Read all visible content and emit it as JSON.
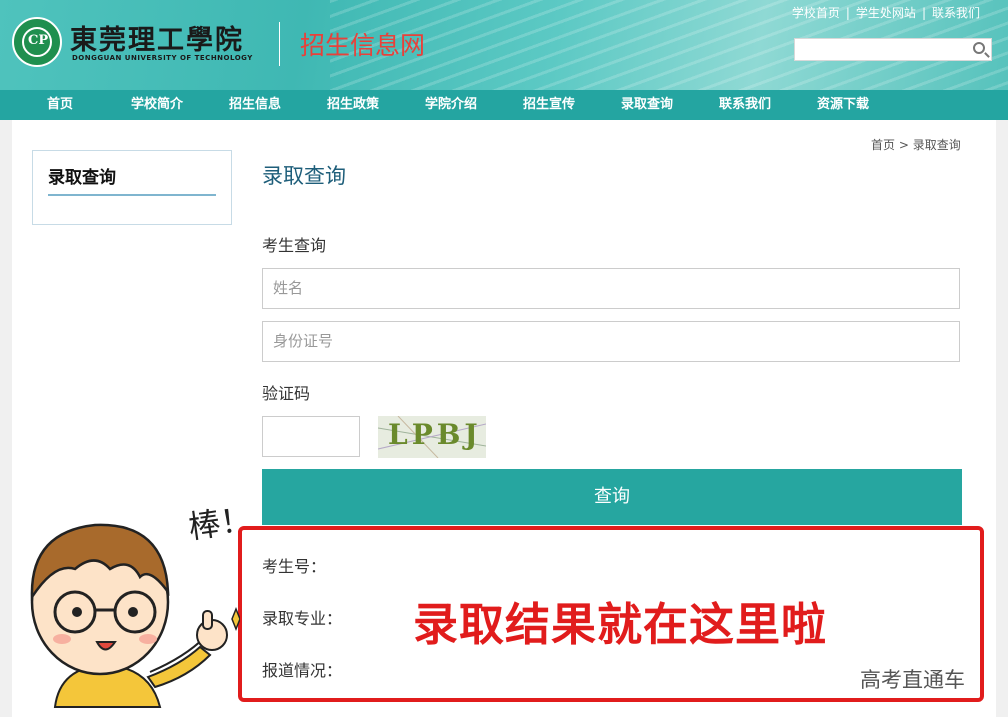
{
  "header": {
    "school_name_cn": "東莞理工學院",
    "school_name_en": "DONGGUAN UNIVERSITY OF TECHNOLOGY",
    "site_title": "招生信息网",
    "top_links": [
      "学校首页",
      "学生处网站",
      "联系我们"
    ],
    "search_placeholder": ""
  },
  "nav": {
    "items": [
      "首页",
      "学校简介",
      "招生信息",
      "招生政策",
      "学院介绍",
      "招生宣传",
      "录取查询",
      "联系我们",
      "资源下载"
    ]
  },
  "sidebar": {
    "title": "录取查询"
  },
  "breadcrumb": {
    "home": "首页",
    "sep": ">",
    "current": "录取查询"
  },
  "main": {
    "page_title": "录取查询",
    "section_label": "考生查询",
    "name_placeholder": "姓名",
    "id_placeholder": "身份证号",
    "captcha_label": "验证码",
    "captcha_text": "LPBJ",
    "submit_label": "查询"
  },
  "result": {
    "student_no_label": "考生号：",
    "major_label": "录取专业：",
    "report_label": "报道情况：",
    "callout": "录取结果就在这里啦"
  },
  "overlay": {
    "sticker_text": "棒！",
    "watermark": "高考直通车"
  },
  "colors": {
    "teal": "#24a5a1",
    "red": "#e11c1c",
    "title_blue": "#1e5e7a"
  }
}
